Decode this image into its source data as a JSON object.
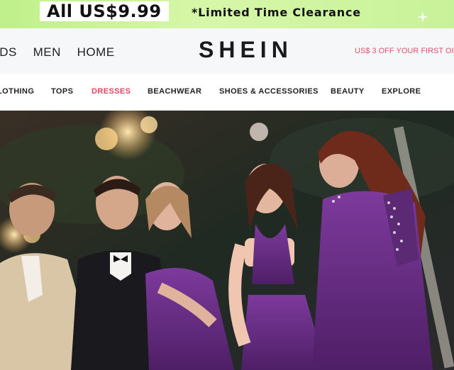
{
  "promo": {
    "price_label": "All US$9.99",
    "text": "*Limited Time Clearance"
  },
  "header": {
    "nav": [
      "IDS",
      "MEN",
      "HOME"
    ],
    "logo": "SHEIN",
    "offer": "US$ 3 OFF YOUR FIRST OI"
  },
  "categories": {
    "items": [
      "LOTHING",
      "TOPS",
      "DRESSES",
      "BEACHWEAR",
      "SHOES & ACCESSORIES",
      "BEAUTY",
      "EXPLORE"
    ],
    "active": "DRESSES"
  },
  "colors": {
    "promo_bg": "#c8f29a",
    "accent": "#e04763",
    "dress_purple": "#6a2f86"
  },
  "hero": {
    "description_icon": "party-photo"
  }
}
